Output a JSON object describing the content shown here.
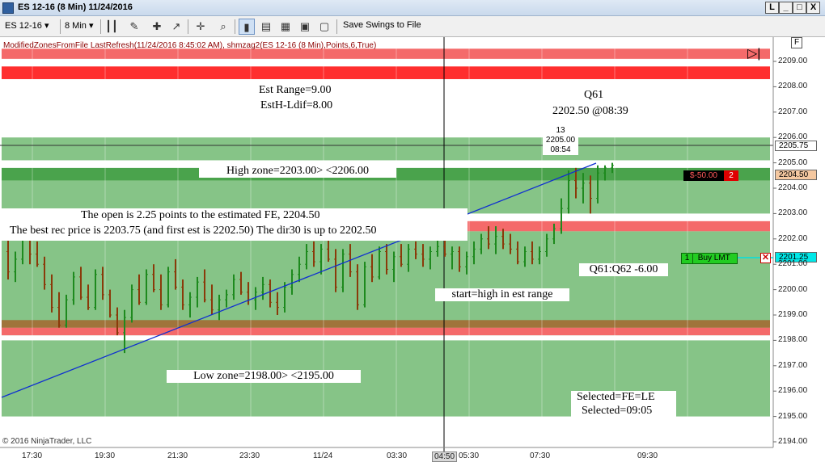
{
  "window": {
    "title": "ES 12-16 (8 Min)  11/24/2016",
    "controls": [
      "L",
      "_",
      "□",
      "X"
    ]
  },
  "toolbar": {
    "instrument": "ES 12-16",
    "interval": "8 Min",
    "save_swings": "Save Swings to File"
  },
  "indicator_line": "ModifiedZonesFromFile LastRefresh(11/24/2016 8:45:02 AM), shmzag2(ES 12-16 (8 Min),Points,6,True)",
  "f_button": "F",
  "copyright": "© 2016 NinjaTrader, LLC",
  "annotations": {
    "est_range": "Est  Range=9.00",
    "esth_ldif": "EstH-Ldif=8.00",
    "q61_title": "Q61",
    "q61_value": "2202.50  @08:39",
    "swing_count": "13",
    "swing_price": "2205.00",
    "swing_time": "08:54",
    "high_zone": "High  zone=2203.00>  <2206.00",
    "open_line1": "The open is 2.25 points to the estimated FE, 2204.50",
    "open_line2": "The best rec price is 2203.75 (and first est is 2202.50) The dir30 is up to 2202.50",
    "q61_q62": "Q61:Q62 -6.00",
    "start_high": "start=high  in  est range",
    "low_zone": "Low  zone=2198.00>  <2195.00",
    "selected1": "Selected=FE=LE",
    "selected2": "Selected=09:05"
  },
  "orders": {
    "position_pnl": "$-50.00",
    "position_qty": "2",
    "position_price": "2204.50",
    "buy_qty": "1",
    "buy_label": "Buy LMT",
    "buy_price": "2201.25",
    "last_price": "2205.75"
  },
  "colors": {
    "zone_green": "#86c487",
    "zone_dark_green": "#4aa34c",
    "zone_red": "#f46a6a",
    "zone_bright_red": "#ff2e2e",
    "zone_brown": "#a0743b",
    "bar_up": "#1e8a1e",
    "bar_down": "#8a3a0a"
  },
  "chart_data": {
    "type": "ohlc",
    "y_ticks": [
      "2209.00",
      "2208.00",
      "2207.00",
      "2206.00",
      "2205.00",
      "2204.00",
      "2203.00",
      "2202.00",
      "2201.00",
      "2200.00",
      "2199.00",
      "2198.00",
      "2197.00",
      "2196.00",
      "2195.00",
      "2194.00"
    ],
    "x_ticks": [
      "17:30",
      "19:30",
      "21:30",
      "23:30",
      "11/24",
      "03:30",
      "04:50",
      "05:30",
      "07:30",
      "09:30"
    ],
    "ylim": [
      2193.9,
      2209.6
    ],
    "zones": [
      {
        "from": 2205.1,
        "to": 2206.0,
        "color": "#86c487"
      },
      {
        "from": 2204.8,
        "to": 2204.3,
        "color": "#4aa34c"
      },
      {
        "from": 2203.0,
        "to": 2204.3,
        "color": "#86c487"
      },
      {
        "from": 2202.7,
        "to": 2202.3,
        "color": "#f46a6a"
      },
      {
        "from": 2198.2,
        "to": 2202.3,
        "color": "#86c487"
      },
      {
        "from": 2198.5,
        "to": 2198.8,
        "color": "#a0743b"
      },
      {
        "from": 2198.2,
        "to": 2198.5,
        "color": "#f46a6a"
      },
      {
        "from": 2195.0,
        "to": 2198.0,
        "color": "#86c487"
      },
      {
        "from": 2208.3,
        "to": 2208.8,
        "color": "#ff2e2e"
      },
      {
        "from": 2209.1,
        "to": 2209.5,
        "color": "#f46a6a"
      }
    ],
    "bars": [
      [
        2201.5,
        2202.0,
        2200.4,
        2200.7
      ],
      [
        2200.7,
        2201.5,
        2200.3,
        2201.2
      ],
      [
        2201.2,
        2202.6,
        2201.0,
        2202.3
      ],
      [
        2202.3,
        2202.6,
        2201.0,
        2201.4
      ],
      [
        2201.4,
        2201.9,
        2200.9,
        2201.0
      ],
      [
        2201.0,
        2201.3,
        2200.0,
        2200.2
      ],
      [
        2200.2,
        2200.6,
        2199.1,
        2199.3
      ],
      [
        2199.3,
        2199.9,
        2198.5,
        2198.6
      ],
      [
        2198.6,
        2199.8,
        2198.5,
        2199.6
      ],
      [
        2199.6,
        2200.7,
        2199.4,
        2200.5
      ],
      [
        2200.5,
        2200.9,
        2199.6,
        2199.7
      ],
      [
        2199.7,
        2200.2,
        2199.2,
        2199.3
      ],
      [
        2199.3,
        2200.8,
        2199.2,
        2200.6
      ],
      [
        2200.6,
        2200.9,
        2199.6,
        2199.8
      ],
      [
        2199.8,
        2200.0,
        2198.9,
        2199.0
      ],
      [
        2199.0,
        2199.3,
        2198.2,
        2198.3
      ],
      [
        2198.3,
        2199.2,
        2197.5,
        2198.9
      ],
      [
        2198.9,
        2200.2,
        2198.7,
        2200.0
      ],
      [
        2200.0,
        2200.6,
        2199.4,
        2199.5
      ],
      [
        2199.5,
        2200.8,
        2199.4,
        2200.6
      ],
      [
        2200.6,
        2201.0,
        2199.9,
        2200.0
      ],
      [
        2200.0,
        2200.6,
        2199.2,
        2199.4
      ],
      [
        2199.4,
        2200.9,
        2199.3,
        2200.7
      ],
      [
        2200.7,
        2201.2,
        2200.0,
        2200.1
      ],
      [
        2200.1,
        2200.4,
        2199.2,
        2199.4
      ],
      [
        2199.4,
        2199.9,
        2198.9,
        2199.7
      ],
      [
        2199.7,
        2200.5,
        2199.3,
        2200.3
      ],
      [
        2200.3,
        2200.8,
        2199.5,
        2199.6
      ],
      [
        2199.6,
        2200.2,
        2199.0,
        2199.2
      ],
      [
        2199.2,
        2199.8,
        2198.8,
        2199.6
      ],
      [
        2199.6,
        2200.0,
        2199.3,
        2199.8
      ],
      [
        2199.8,
        2200.6,
        2199.6,
        2200.4
      ],
      [
        2200.4,
        2200.7,
        2199.8,
        2199.9
      ],
      [
        2199.9,
        2200.3,
        2199.4,
        2199.6
      ],
      [
        2199.6,
        2200.1,
        2199.2,
        2199.9
      ],
      [
        2199.9,
        2200.5,
        2199.6,
        2200.2
      ],
      [
        2200.2,
        2200.4,
        2199.3,
        2199.5
      ],
      [
        2199.5,
        2199.9,
        2199.0,
        2199.3
      ],
      [
        2199.3,
        2200.3,
        2199.1,
        2200.1
      ],
      [
        2200.1,
        2200.8,
        2199.8,
        2200.6
      ],
      [
        2200.6,
        2201.3,
        2200.3,
        2201.0
      ],
      [
        2201.0,
        2201.8,
        2200.8,
        2201.5
      ],
      [
        2201.5,
        2201.9,
        2200.9,
        2201.1
      ],
      [
        2201.1,
        2201.8,
        2200.6,
        2201.6
      ],
      [
        2201.6,
        2202.2,
        2201.1,
        2201.2
      ],
      [
        2201.2,
        2201.6,
        2199.9,
        2200.1
      ],
      [
        2200.1,
        2201.6,
        2199.9,
        2201.4
      ],
      [
        2201.4,
        2201.8,
        2200.5,
        2200.7
      ],
      [
        2200.7,
        2201.0,
        2199.2,
        2199.4
      ],
      [
        2199.4,
        2201.1,
        2199.3,
        2200.9
      ],
      [
        2200.9,
        2201.4,
        2200.3,
        2200.5
      ],
      [
        2200.5,
        2201.7,
        2200.4,
        2201.5
      ],
      [
        2201.5,
        2201.8,
        2200.6,
        2200.8
      ],
      [
        2200.8,
        2201.5,
        2200.3,
        2201.3
      ],
      [
        2201.3,
        2201.8,
        2200.9,
        2201.0
      ],
      [
        2201.0,
        2201.8,
        2200.7,
        2201.6
      ],
      [
        2201.6,
        2201.9,
        2201.2,
        2201.4
      ],
      [
        2201.4,
        2201.8,
        2200.9,
        2201.2
      ],
      [
        2201.2,
        2201.7,
        2200.8,
        2201.5
      ],
      [
        2201.5,
        2202.0,
        2201.3,
        2201.7
      ],
      [
        2201.7,
        2202.1,
        2201.3,
        2201.4
      ],
      [
        2201.4,
        2201.7,
        2200.8,
        2201.5
      ],
      [
        2201.5,
        2201.7,
        2200.7,
        2200.9
      ],
      [
        2200.9,
        2201.5,
        2200.6,
        2201.3
      ],
      [
        2201.3,
        2201.9,
        2201.0,
        2201.6
      ],
      [
        2201.6,
        2202.2,
        2201.4,
        2202.0
      ],
      [
        2202.0,
        2202.5,
        2201.6,
        2201.8
      ],
      [
        2201.8,
        2202.5,
        2201.4,
        2202.1
      ],
      [
        2202.1,
        2202.4,
        2201.6,
        2201.8
      ],
      [
        2201.8,
        2202.2,
        2201.4,
        2201.6
      ],
      [
        2201.6,
        2201.9,
        2201.0,
        2201.1
      ],
      [
        2201.1,
        2201.7,
        2200.9,
        2201.5
      ],
      [
        2201.5,
        2201.9,
        2201.0,
        2201.2
      ],
      [
        2201.2,
        2201.7,
        2201.0,
        2201.5
      ],
      [
        2201.5,
        2202.2,
        2201.3,
        2202.0
      ],
      [
        2202.0,
        2202.6,
        2201.8,
        2202.4
      ],
      [
        2202.4,
        2203.6,
        2202.2,
        2203.2
      ],
      [
        2203.2,
        2204.7,
        2203.0,
        2204.3
      ],
      [
        2204.3,
        2204.8,
        2203.6,
        2204.0
      ],
      [
        2204.0,
        2204.6,
        2203.4,
        2204.2
      ],
      [
        2204.2,
        2204.5,
        2203.0,
        2203.6
      ],
      [
        2203.6,
        2204.9,
        2203.4,
        2204.6
      ],
      [
        2204.6,
        2204.9,
        2204.3,
        2204.8
      ],
      [
        2204.8,
        2205.0,
        2204.6,
        2204.9
      ]
    ]
  }
}
